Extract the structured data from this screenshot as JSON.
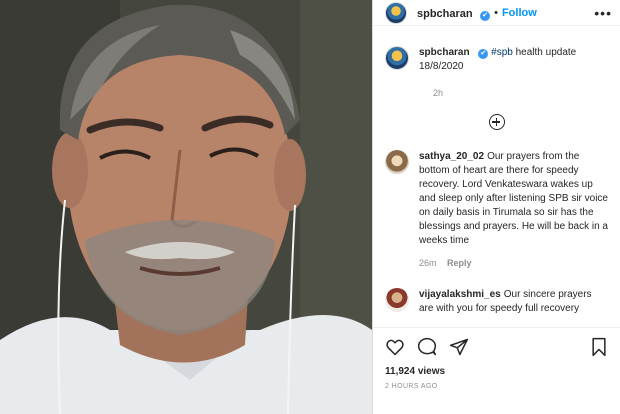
{
  "post": {
    "username": "spbcharan",
    "follow_label": "Follow",
    "separator": "•",
    "more_label": "•••",
    "verified_mark": "✔"
  },
  "caption": {
    "username": "spbcharan",
    "hashtag": "#spb",
    "text": " health update",
    "date": "18/8/2020",
    "time": "2h"
  },
  "comments": [
    {
      "user": "sathya_20_02",
      "text": "Our prayers from the bottom of heart are there for speedy recovery. Lord Venkateswara wakes up and sleep only after listening SPB sir voice on daily basis in Tirumala so sir has the blessings and prayers. He will be back in a weeks time",
      "time": "26m",
      "reply": "Reply"
    },
    {
      "user": "vijayalakshmi_es",
      "text": "Our sincere prayers are with you for speedy full recovery",
      "time": "",
      "reply": ""
    }
  ],
  "stats": {
    "views": "11,924 views",
    "ago": "2 HOURS AGO"
  },
  "icons": [
    "heart-icon",
    "comment-icon",
    "share-icon",
    "bookmark-icon",
    "add-comment-icon",
    "verified-icon",
    "more-options-icon"
  ],
  "colors": {
    "link": "#0095f6",
    "verified": "#3897f0",
    "muted": "#8e8e8e",
    "hashtag": "#00376b"
  }
}
